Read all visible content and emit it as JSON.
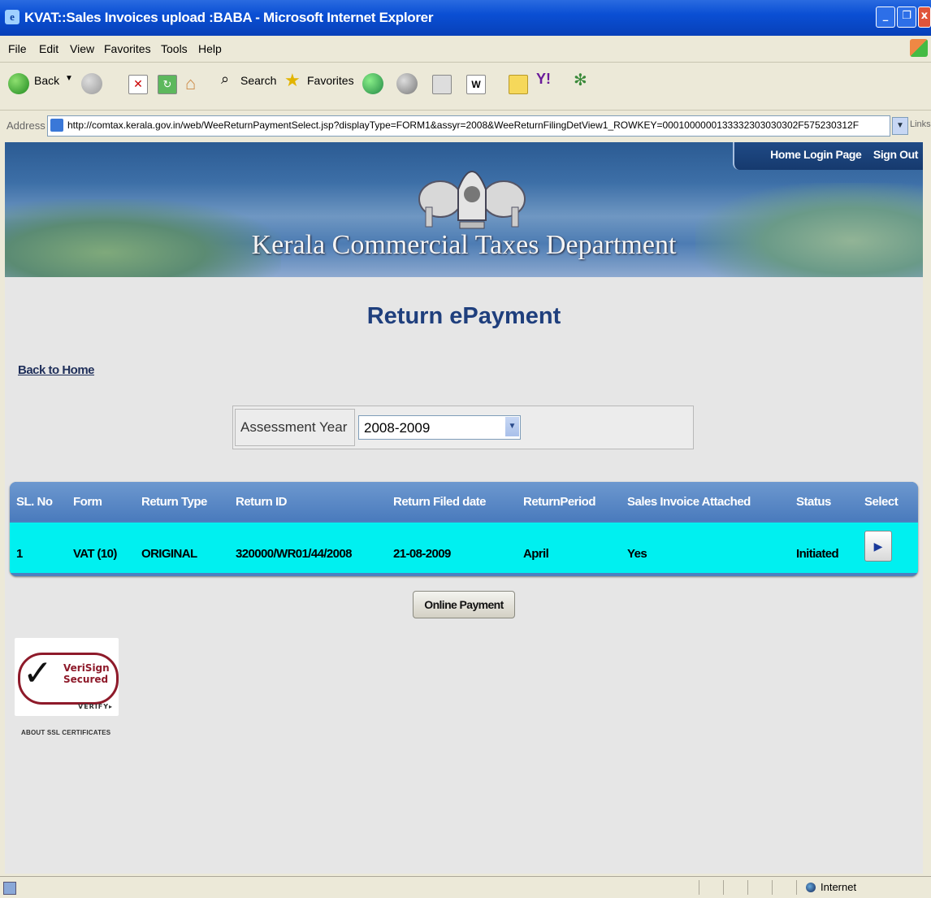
{
  "window": {
    "title": "KVAT::Sales Invoices upload :BABA - Microsoft Internet Explorer"
  },
  "menu": [
    "File",
    "Edit",
    "View",
    "Favorites",
    "Tools",
    "Help"
  ],
  "toolbar": {
    "back": "Back",
    "search": "Search",
    "favorites": "Favorites"
  },
  "address": {
    "label": "Address",
    "url": "http://comtax.kerala.gov.in/web/WeeReturnPaymentSelect.jsp?displayType=FORM1&assyr=2008&WeeReturnFilingDetView1_ROWKEY=0001000000133332303030302F575230312F",
    "links": "Links"
  },
  "header": {
    "department": "Kerala Commercial Taxes Department",
    "home_login": "Home Login Page",
    "sign_out": "Sign Out"
  },
  "page": {
    "title": "Return ePayment",
    "back_link": "Back to Home"
  },
  "assessment": {
    "label": "Assessment Year",
    "value": "2008-2009"
  },
  "table": {
    "columns": [
      "SL. No",
      "Form",
      "Return Type",
      "Return ID",
      "Return Filed date",
      "ReturnPeriod",
      "Sales Invoice Attached",
      "Status",
      "Select"
    ],
    "rows": [
      {
        "sl": "1",
        "form": "VAT (10)",
        "return_type": "ORIGINAL",
        "return_id": "320000/WR01/44/2008",
        "filed_date": "21-08-2009",
        "period": "April",
        "invoice_attached": "Yes",
        "status": "Initiated"
      }
    ]
  },
  "actions": {
    "online_payment": "Online Payment"
  },
  "badge": {
    "line1": "VeriSign",
    "line2": "Secured",
    "verify": "VERIFY▸",
    "ssl": "ABOUT SSL CERTIFICATES"
  },
  "status": {
    "zone": "Internet"
  },
  "colors": {
    "title_blue": "#1f3f7d",
    "grid_head": "#4a7bbd",
    "row_cyan": "#00f0f0"
  }
}
